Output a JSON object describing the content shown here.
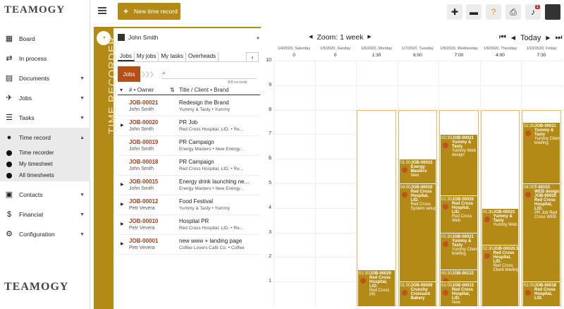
{
  "brand": "TEAMOGY",
  "sidebar": {
    "items": [
      {
        "label": "Board"
      },
      {
        "label": "In process"
      },
      {
        "label": "Documents"
      },
      {
        "label": "Jobs"
      },
      {
        "label": "Tasks"
      },
      {
        "label": "Time record"
      },
      {
        "label": "Contacts"
      },
      {
        "label": "Financial"
      },
      {
        "label": "Configuration"
      }
    ],
    "sub": [
      "Time recorder",
      "My timesheet",
      "All timesheets"
    ]
  },
  "topbar": {
    "new_label": "New time record",
    "bell_count": "1"
  },
  "recorder": {
    "vertical": "TIME RECORDER",
    "user": "John Smith",
    "tabs": [
      "Jobs",
      "My jobs",
      "My tasks",
      "Overheads"
    ],
    "jobs_button": "Jobs",
    "records": "8/8 records",
    "col_owner": "# • Owner",
    "col_title": "Title / Client • Brand",
    "rows": [
      {
        "job": "JOB-00021",
        "owner": "John Smith",
        "title": "Redesign the Brand",
        "client": "Yummy & Tasty • Yummy",
        "arrow": false
      },
      {
        "job": "JOB-00020",
        "owner": "John Smith",
        "title": "PR Job",
        "client": "Red Cross Hospital, LtD. • Re...",
        "arrow": true
      },
      {
        "job": "JOB-00019",
        "owner": "John Smith",
        "title": "PR Campaign",
        "client": "Energy Masters • New Energy...",
        "arrow": false
      },
      {
        "job": "JOB-00018",
        "owner": "John Smith",
        "title": "PR Campaign",
        "client": "Red Cross Hospital, LtD. • Re...",
        "arrow": false
      },
      {
        "job": "JOB-00015",
        "owner": "John Smith",
        "title": "Energy drink launching ne...",
        "client": "Energy Masters • New Energy...",
        "arrow": true
      },
      {
        "job": "JOB-00012",
        "owner": "Petr Vevera",
        "title": "Food Festival",
        "client": "Yummy & Tasty • Yummy",
        "arrow": true
      },
      {
        "job": "JOB-00010",
        "owner": "Petr Vevera",
        "title": "Hospital PR",
        "client": "Red Cross Hospital, LtD. • Re...",
        "arrow": true
      },
      {
        "job": "JOB-00001",
        "owner": "Petr Vevera",
        "title": "new www + landing page",
        "client": "Coffee Lovers Café Co. • Coffee",
        "arrow": true
      }
    ]
  },
  "calendar": {
    "zoom": "Zoom: 1 week",
    "today": "Today",
    "days": [
      {
        "date": "1/4/2020, Saturday",
        "hours": "0"
      },
      {
        "date": "1/5/2020, Sunday",
        "hours": "0"
      },
      {
        "date": "1/6/2020, Monday",
        "hours": "1:30"
      },
      {
        "date": "1/7/2020, Tuesday",
        "hours": "6:00"
      },
      {
        "date": "1/8/2020, Wednesday",
        "hours": "7:00"
      },
      {
        "date": "1/9/2020, Thursday",
        "hours": "4:00"
      },
      {
        "date": "1/10/2020, Friday",
        "hours": "7:30"
      }
    ],
    "yticks": [
      "10",
      "9",
      "8",
      "7",
      "6",
      "5",
      "4",
      "3",
      "2",
      "1"
    ],
    "events": [
      {
        "day": 2,
        "start": 0,
        "h": 1.5,
        "time": "01:30",
        "title": "JOB-00020\nRed Cross Hospital, LtD.",
        "sub": "Red Cross PR"
      },
      {
        "day": 3,
        "start": 0,
        "h": 1,
        "time": "01:00",
        "title": "JOB-00009\nCrunchy Croissant Bakery",
        "sub": ""
      },
      {
        "day": 3,
        "start": 1,
        "h": 4,
        "time": "04:00",
        "title": "JOB-00010\nRed Cross Hospital, LtD.",
        "sub": "Red Cross System setup"
      },
      {
        "day": 3,
        "start": 5,
        "h": 1,
        "time": "01:00",
        "title": "JOB-00015\nEnergy Masters",
        "sub": "New"
      },
      {
        "day": 4,
        "start": 0,
        "h": 1,
        "time": "01:00",
        "title": "JOB-00015\nRed Cross Hospital, LtD.",
        "sub": "New"
      },
      {
        "day": 4,
        "start": 1,
        "h": 0.5,
        "time": "00:30",
        "title": "JOB-00122",
        "sub": ""
      },
      {
        "day": 4,
        "start": 1.5,
        "h": 1.5,
        "time": "01:30",
        "title": "JOB-00021\nYummy & Tasty",
        "sub": "Yummy Client briefing"
      },
      {
        "day": 4,
        "start": 3,
        "h": 1.5,
        "time": "01:30",
        "title": "JOB-00020\nRed Cross Hospital, LtD.",
        "sub": "Red Cross Web"
      },
      {
        "day": 4,
        "start": 4.5,
        "h": 2.5,
        "time": "02:30",
        "title": "JOB-00021\nYummy & Tasty",
        "sub": "Yummy Web design"
      },
      {
        "day": 5,
        "start": 0,
        "h": 2.5,
        "time": "02:30",
        "title": "JOB-00020.5\nRed Cross Hospital, LtD.",
        "sub": "Red Cross Client briefing"
      },
      {
        "day": 5,
        "start": 2.5,
        "h": 1.5,
        "time": "01:30",
        "title": "JOB-00021\nYummy & Tasty",
        "sub": "Yummy Web"
      },
      {
        "day": 6,
        "start": 0,
        "h": 1,
        "time": "01:00",
        "title": "JOB-00018\nRed Cross Hospital, LtD.",
        "sub": ""
      },
      {
        "day": 6,
        "start": 1,
        "h": 4,
        "time": "04:00",
        "title": "T-00153\nWEB design\nJOB-00020\nRed Cross Hospital, LtD.",
        "sub": "PR Job Red Cross WEB"
      },
      {
        "day": 6,
        "start": 5,
        "h": 2.5,
        "time": "02:30",
        "title": "JOB-00021\nYummy & Tasty",
        "sub": "Yummy Client briefing"
      }
    ]
  }
}
